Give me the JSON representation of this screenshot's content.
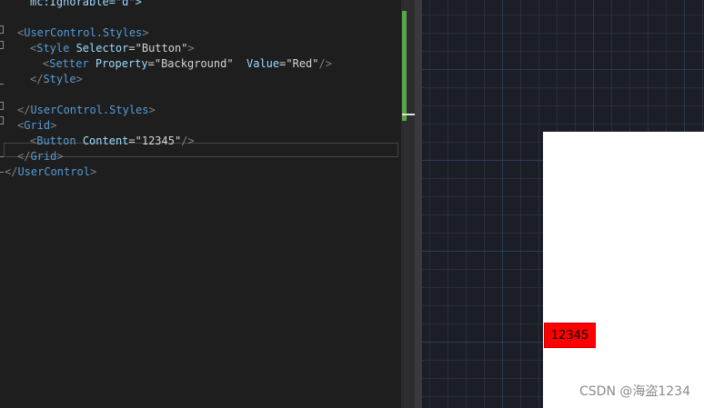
{
  "editor": {
    "lines": [
      {
        "indent": "    ",
        "parts": [
          {
            "t": "mc:Ignorable=\"d\">",
            "c": "c-attr"
          }
        ]
      },
      {
        "indent": "",
        "parts": []
      },
      {
        "indent": "  ",
        "parts": [
          {
            "t": "<",
            "c": "c-punct"
          },
          {
            "t": "UserControl.Styles",
            "c": "c-tag"
          },
          {
            "t": ">",
            "c": "c-punct"
          }
        ]
      },
      {
        "indent": "    ",
        "parts": [
          {
            "t": "<",
            "c": "c-punct"
          },
          {
            "t": "Style",
            "c": "c-tag"
          },
          {
            "t": " Selector",
            "c": "c-attr"
          },
          {
            "t": "=",
            "c": "c-plain"
          },
          {
            "t": "\"Button\"",
            "c": "c-plain"
          },
          {
            "t": ">",
            "c": "c-punct"
          }
        ]
      },
      {
        "indent": "      ",
        "parts": [
          {
            "t": "<",
            "c": "c-punct"
          },
          {
            "t": "Setter",
            "c": "c-tag"
          },
          {
            "t": " Property",
            "c": "c-attr"
          },
          {
            "t": "=",
            "c": "c-plain"
          },
          {
            "t": "\"Background\"",
            "c": "c-plain"
          },
          {
            "t": "  Value",
            "c": "c-attr"
          },
          {
            "t": "=",
            "c": "c-plain"
          },
          {
            "t": "\"Red\"",
            "c": "c-plain"
          },
          {
            "t": "/>",
            "c": "c-punct"
          }
        ]
      },
      {
        "indent": "    ",
        "parts": [
          {
            "t": "</",
            "c": "c-punct"
          },
          {
            "t": "Style",
            "c": "c-tag"
          },
          {
            "t": ">",
            "c": "c-punct"
          }
        ]
      },
      {
        "indent": "",
        "parts": []
      },
      {
        "indent": "  ",
        "parts": [
          {
            "t": "</",
            "c": "c-punct"
          },
          {
            "t": "UserControl.Styles",
            "c": "c-tag"
          },
          {
            "t": ">",
            "c": "c-punct"
          }
        ]
      },
      {
        "indent": "  ",
        "parts": [
          {
            "t": "<",
            "c": "c-punct"
          },
          {
            "t": "Grid",
            "c": "c-tag"
          },
          {
            "t": ">",
            "c": "c-punct"
          }
        ]
      },
      {
        "indent": "    ",
        "parts": [
          {
            "t": "<",
            "c": "c-punct"
          },
          {
            "t": "Button",
            "c": "c-tag"
          },
          {
            "t": " Content",
            "c": "c-attr"
          },
          {
            "t": "=",
            "c": "c-plain"
          },
          {
            "t": "\"12345\"",
            "c": "c-plain"
          },
          {
            "t": "/>",
            "c": "c-punct"
          }
        ]
      },
      {
        "indent": "  ",
        "parts": [
          {
            "t": "</",
            "c": "c-punct"
          },
          {
            "t": "Grid",
            "c": "c-tag"
          },
          {
            "t": ">",
            "c": "c-punct"
          }
        ]
      },
      {
        "indent": "",
        "parts": [
          {
            "t": "</",
            "c": "c-punct"
          },
          {
            "t": "UserControl",
            "c": "c-tag"
          },
          {
            "t": ">",
            "c": "c-punct"
          }
        ]
      }
    ]
  },
  "designer": {
    "button_content": "12345"
  },
  "watermark": "CSDN @海盗1234",
  "colors": {
    "editor_bg": "#1e1e1e",
    "tag": "#569cd6",
    "attribute": "#9cdcfe",
    "punctuation": "#808080",
    "change_bar": "#57a64a",
    "button_background": "Red"
  }
}
